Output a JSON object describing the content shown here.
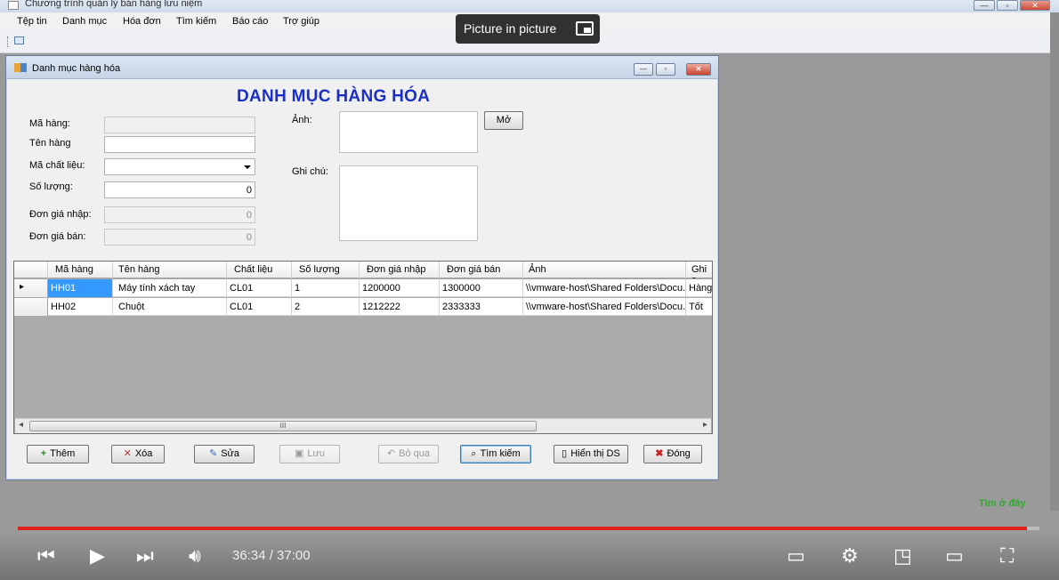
{
  "window": {
    "title": "Chương trình quản lý bán hàng lưu niệm",
    "min": "—",
    "max": "▫",
    "close": "✕"
  },
  "menu": [
    "Tệp tin",
    "Danh mục",
    "Hóa đơn",
    "Tìm kiếm",
    "Báo cáo",
    "Trợ giúp"
  ],
  "pip": {
    "label": "Picture in picture",
    "icon": "pip-exit-icon"
  },
  "form": {
    "title": "Danh mục hàng hóa",
    "heading": "DANH MỤC HÀNG HÓA",
    "labels": {
      "ma_hang": "Mã hàng:",
      "ten_hang": "Tên hàng",
      "ma_chat_lieu": "Mã chất liệu:",
      "so_luong": "Số lượng:",
      "don_gia_nhap": "Đơn giá nhập:",
      "don_gia_ban": "Đơn giá bán:",
      "anh": "Ảnh:",
      "ghi_chu": "Ghi chú:"
    },
    "values": {
      "ma_hang": "",
      "ten_hang": "",
      "ma_chat_lieu": "",
      "so_luong": "0",
      "don_gia_nhap": "0",
      "don_gia_ban": "0"
    },
    "mo_button": "Mở"
  },
  "grid": {
    "columns": [
      "Mã hàng",
      "Tên hàng",
      "Chất liệu",
      "Số lượng",
      "Đơn giá nhập",
      "Đơn giá bán",
      "Ảnh",
      "Ghi c"
    ],
    "rows": [
      [
        "HH01",
        "Máy tính xách tay",
        "CL01",
        "1",
        "1200000",
        "1300000",
        "\\\\vmware-host\\Shared Folders\\Docu...",
        "Hàng"
      ],
      [
        "HH02",
        "Chuột",
        "CL01",
        "2",
        "1212222",
        "2333333",
        "\\\\vmware-host\\Shared Folders\\Docu...",
        "Tốt"
      ]
    ],
    "current_row_marker": "▸",
    "scroll_thumb": "III",
    "scroll_left": "◂",
    "scroll_right": "▸"
  },
  "buttons": {
    "them": "Thêm",
    "xoa": "Xóa",
    "sua": "Sửa",
    "luu": "Lưu",
    "bo_qua": "Bỏ qua",
    "tim_kiem": "Tìm kiếm",
    "hien_thi_ds": "Hiển thị DS",
    "dong": "Đóng"
  },
  "video": {
    "watermark": "Tìm ở đây",
    "time": "36:34 / 37:00",
    "progress_fraction": 0.988,
    "accent_color": "#e1221c"
  }
}
